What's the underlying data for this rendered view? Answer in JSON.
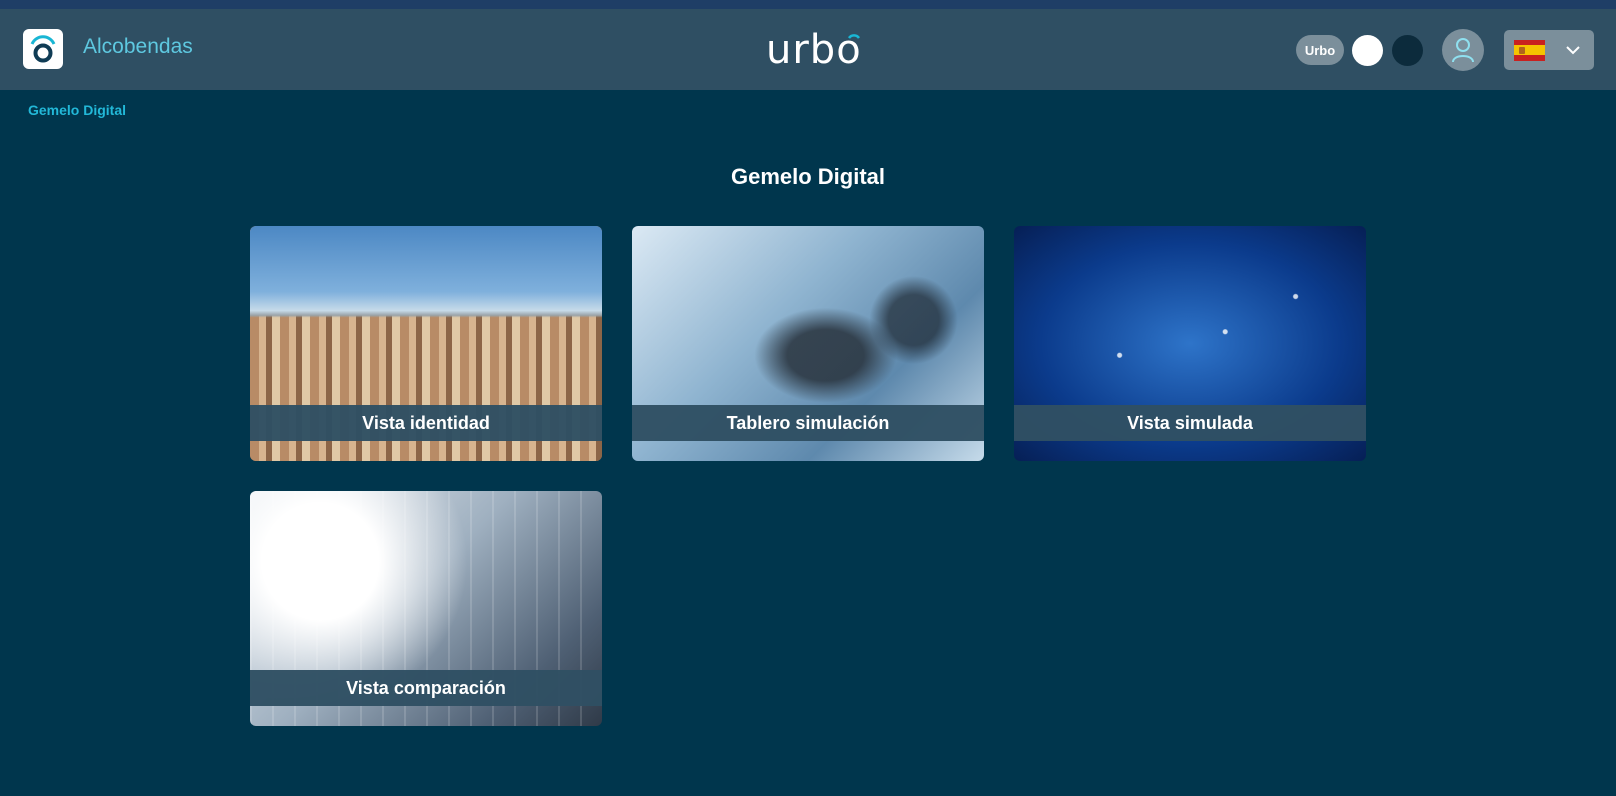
{
  "header": {
    "city": "Alcobendas",
    "brand": "urbo",
    "theme_label": "Urbo",
    "language": "Español"
  },
  "breadcrumb": "Gemelo Digital",
  "page_title": "Gemelo Digital",
  "cards": [
    {
      "label": "Vista identidad"
    },
    {
      "label": "Tablero simulación"
    },
    {
      "label": "Vista simulada"
    },
    {
      "label": "Vista comparación"
    }
  ],
  "colors": {
    "background": "#00364d",
    "header": "#2f4f63",
    "accent": "#22b8d8",
    "card_label_bg": "#2f4f63"
  },
  "icons": [
    "urbo-logo-icon",
    "user-icon",
    "spain-flag-icon",
    "chevron-down-icon"
  ]
}
